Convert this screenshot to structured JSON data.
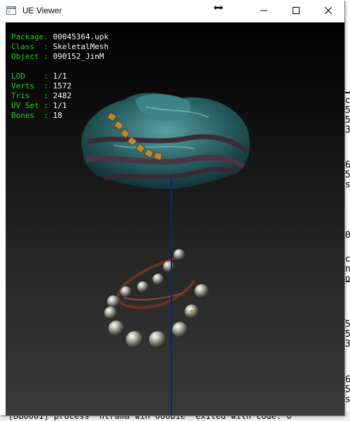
{
  "window": {
    "title": "UE Viewer",
    "buttons": {
      "minimize": "minimize",
      "maximize": "maximize",
      "close": "close"
    }
  },
  "info_panel": {
    "package_label": "Package: ",
    "package_value": "00045364.upk",
    "class_label": "Class  : ",
    "class_value": "SkeletalMesh",
    "object_label": "Object : ",
    "object_value": "090152_JinM",
    "lod_label": "LOD    : ",
    "lod_value": "1/1",
    "verts_label": "Verts  : ",
    "verts_value": "1572",
    "tris_label": "Tris   : ",
    "tris_value": "2482",
    "uvset_label": "UV Set : ",
    "uvset_value": "1/1",
    "bones_label": "Bones  : ",
    "bones_value": "18"
  },
  "background_console": {
    "fragments": [
      "c",
      "5",
      "5",
      "3",
      "6",
      "5",
      "s",
      "0",
      "c",
      "n",
      "o",
      "5",
      "5",
      "3",
      "6",
      "5",
      "s",
      "E"
    ],
    "bottom_line": "[DB0001] process 'ntrama win 000b1e' exited with code: 0"
  },
  "colors": {
    "label_green": "#1fd11f",
    "axis_blue": "#0a1fa0",
    "fabric_teal": "#2e6b6e"
  }
}
